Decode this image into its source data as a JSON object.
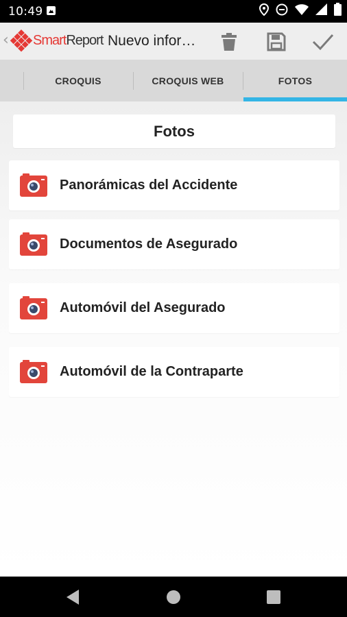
{
  "status": {
    "time": "10:49"
  },
  "app_bar": {
    "logo_smart": "Smart",
    "logo_report": "Report",
    "title": "Nuevo infor…"
  },
  "tabs": [
    {
      "label": "CROQUIS"
    },
    {
      "label": "CROQUIS WEB"
    },
    {
      "label": "FOTOS",
      "selected": true
    }
  ],
  "colors": {
    "accent": "#33b5e5",
    "brand_red": "#e53935",
    "camera_red": "#e2453b"
  },
  "section_title": "Fotos",
  "items": [
    {
      "label": "Panorámicas del Accidente",
      "icon": "camera-icon"
    },
    {
      "label": "Documentos de Asegurado",
      "icon": "camera-icon"
    },
    {
      "label": "Automóvil del Asegurado",
      "icon": "camera-icon"
    },
    {
      "label": "Automóvil de la Contraparte",
      "icon": "camera-icon"
    }
  ]
}
